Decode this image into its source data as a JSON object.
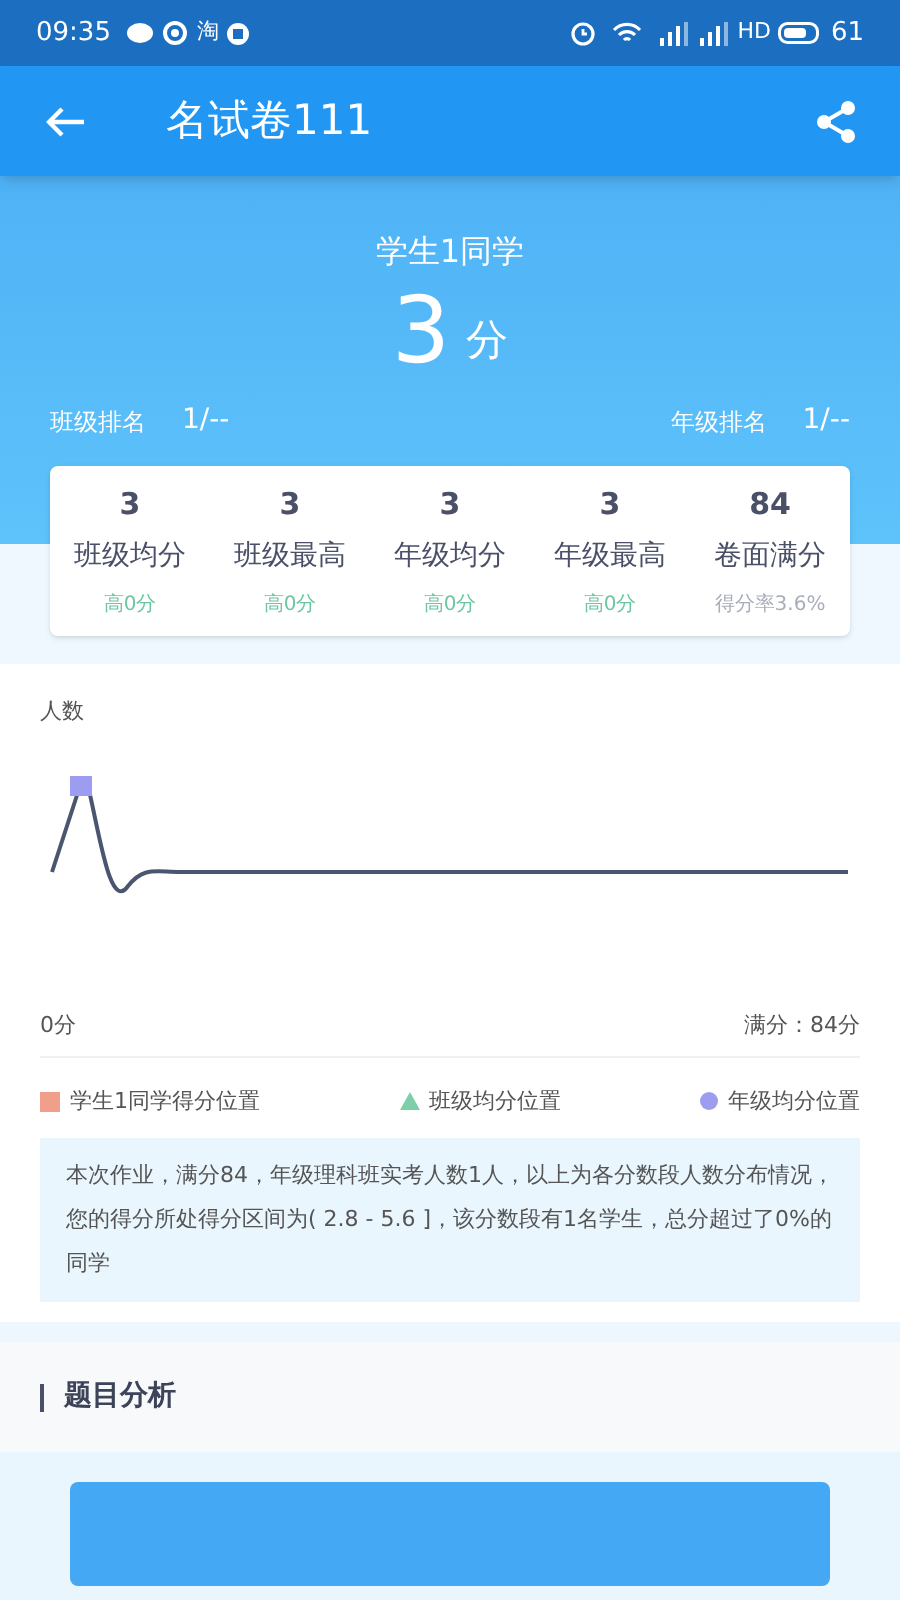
{
  "status_bar": {
    "time": "09:35",
    "app_glyph": "淘",
    "network": "HD",
    "battery": "61"
  },
  "app_bar": {
    "title": "名试卷111"
  },
  "header": {
    "student": "学生1同学",
    "score": "3",
    "unit": "分",
    "ranks": [
      {
        "label": "班级排名",
        "value": "1/--"
      },
      {
        "label": "年级排名",
        "value": "1/--"
      }
    ]
  },
  "stats": [
    {
      "value": "3",
      "label": "班级均分",
      "note": "高0分",
      "kind": "diff"
    },
    {
      "value": "3",
      "label": "班级最高",
      "note": "高0分",
      "kind": "diff"
    },
    {
      "value": "3",
      "label": "年级均分",
      "note": "高0分",
      "kind": "diff"
    },
    {
      "value": "3",
      "label": "年级最高",
      "note": "高0分",
      "kind": "diff"
    },
    {
      "value": "84",
      "label": "卷面满分",
      "note": "得分率3.6%",
      "kind": "rate"
    }
  ],
  "distribution": {
    "ylabel": "人数",
    "x_start": "0分",
    "x_end": "满分：84分",
    "legend": [
      {
        "label": "学生1同学得分位置",
        "kind": "square",
        "color": "#f0a08a"
      },
      {
        "label": "班级均分位置",
        "kind": "triangle",
        "color": "#7ccfa8"
      },
      {
        "label": "年级均分位置",
        "kind": "circle",
        "color": "#9c9cf0"
      }
    ],
    "summary": "本次作业，满分84，年级理科班实考人数1人，以上为各分数段人数分布情况，您的得分所处得分区间为( 2.8 - 5.6 ]，该分数段有1名学生，总分超过了0%的同学"
  },
  "section": {
    "title": "题目分析"
  }
}
